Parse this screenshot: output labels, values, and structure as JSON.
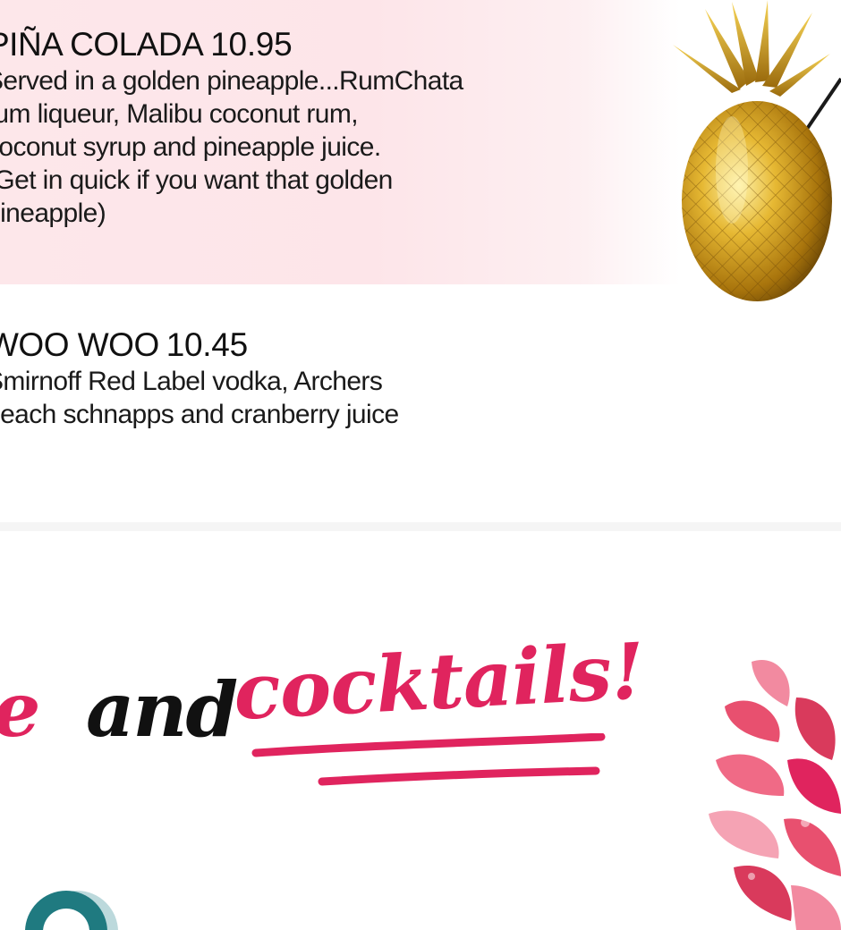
{
  "menu": {
    "items": [
      {
        "name": "PIÑA COLADA",
        "price": "10.95",
        "description_lines": [
          "Served in a golden pineapple...RumChata",
          "rum liqueur, Malibu coconut rum,",
          "coconut syrup and pineapple juice.",
          "(Get in quick if you want that golden",
          "pineapple)"
        ]
      },
      {
        "name": "WOO WOO",
        "price": "10.45",
        "description_lines": [
          "Smirnoff Red Label vodka, Archers",
          "peach schnapps and cranberry juice"
        ]
      }
    ]
  },
  "headline": {
    "prefix": "e",
    "connector": "and",
    "highlight": "cocktails!"
  },
  "colors": {
    "accent": "#e0245e",
    "pink_band": "#fde7ea",
    "gold": "#c99a1a",
    "teal": "#1f7a80"
  },
  "icons": {
    "pineapple_cup": "gold-pineapple-cup",
    "flower": "pink-flower",
    "logo": "teal-ring-logo"
  }
}
